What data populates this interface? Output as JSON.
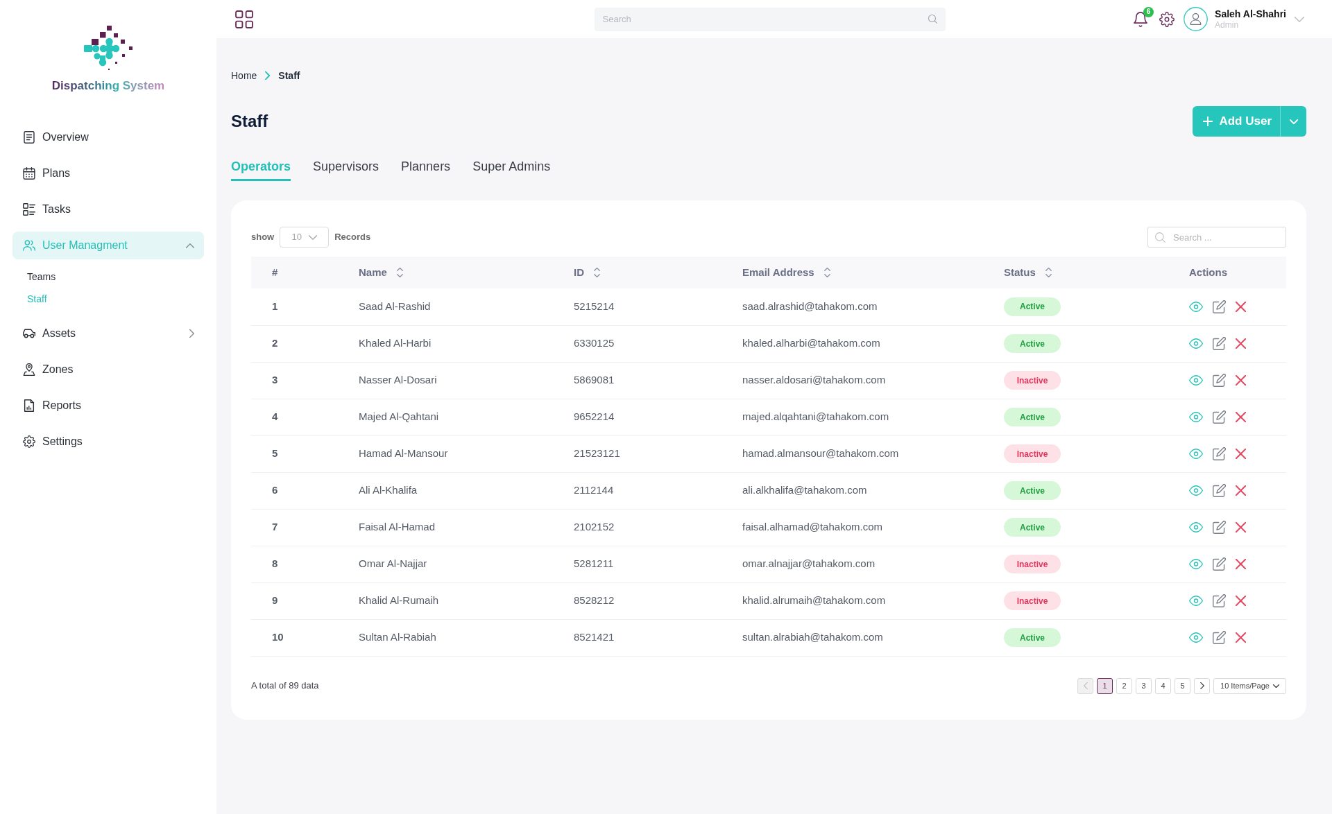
{
  "sidebar": {
    "logo_text": "Dispatching System",
    "items": [
      {
        "label": "Overview",
        "kind": "link",
        "selected": false
      },
      {
        "label": "Plans",
        "kind": "link",
        "selected": false
      },
      {
        "label": "Tasks",
        "kind": "link",
        "selected": false
      },
      {
        "label": "User Managment",
        "kind": "group",
        "selected": true,
        "expanded": true,
        "children": [
          {
            "label": "Teams",
            "selected": false
          },
          {
            "label": "Staff",
            "selected": true
          }
        ]
      },
      {
        "label": "Assets",
        "kind": "group",
        "selected": false,
        "expanded": false
      },
      {
        "label": "Zones",
        "kind": "link",
        "selected": false
      },
      {
        "label": "Reports",
        "kind": "link",
        "selected": false
      },
      {
        "label": "Settings",
        "kind": "link",
        "selected": false
      }
    ]
  },
  "top_bar": {
    "search": {
      "placeholder": "Search"
    },
    "notification_count": "6",
    "user": {
      "name": "Saleh Al-Shahri",
      "role": "Admin"
    }
  },
  "breadcrumb": [
    "Home",
    "Staff"
  ],
  "page_title": "Staff",
  "primary_action": {
    "label": "Add User"
  },
  "tabs": [
    {
      "label": "Operators",
      "selected": true
    },
    {
      "label": "Supervisors",
      "selected": false
    },
    {
      "label": "Planners",
      "selected": false
    },
    {
      "label": "Super Admins",
      "selected": false
    }
  ],
  "table": {
    "page_size": {
      "prefix": "show",
      "value": "10",
      "suffix": "Records"
    },
    "search": {
      "placeholder": "Search ..."
    },
    "columns": [
      {
        "label": "#",
        "sortable": false
      },
      {
        "label": "Name",
        "sortable": true
      },
      {
        "label": "ID",
        "sortable": true
      },
      {
        "label": "Email Address",
        "sortable": true
      },
      {
        "label": "Status",
        "sortable": true
      },
      {
        "label": "Actions",
        "sortable": false
      }
    ],
    "rows": [
      {
        "number": "1",
        "name": "Saad Al-Rashid",
        "id": "5215214",
        "email": "saad.alrashid@tahakom.com",
        "status": "Active",
        "active": true
      },
      {
        "number": "2",
        "name": "Khaled Al-Harbi",
        "id": "6330125",
        "email": "khaled.alharbi@tahakom.com",
        "status": "Active",
        "active": true
      },
      {
        "number": "3",
        "name": "Nasser Al-Dosari",
        "id": "5869081",
        "email": "nasser.aldosari@tahakom.com",
        "status": "Inactive",
        "active": false
      },
      {
        "number": "4",
        "name": "Majed Al-Qahtani",
        "id": "9652214",
        "email": "majed.alqahtani@tahakom.com",
        "status": "Active",
        "active": true
      },
      {
        "number": "5",
        "name": "Hamad Al-Mansour",
        "id": "21523121",
        "email": "hamad.almansour@tahakom.com",
        "status": "Inactive",
        "active": false
      },
      {
        "number": "6",
        "name": "Ali Al-Khalifa",
        "id": "2112144",
        "email": "ali.alkhalifa@tahakom.com",
        "status": "Active",
        "active": true
      },
      {
        "number": "7",
        "name": "Faisal Al-Hamad",
        "id": "2102152",
        "email": "faisal.alhamad@tahakom.com",
        "status": "Active",
        "active": true
      },
      {
        "number": "8",
        "name": "Omar Al-Najjar",
        "id": "5281211",
        "email": "omar.alnajjar@tahakom.com",
        "status": "Inactive",
        "active": false
      },
      {
        "number": "9",
        "name": "Khalid Al-Rumaih",
        "id": "8528212",
        "email": "khalid.alrumaih@tahakom.com",
        "status": "Inactive",
        "active": false
      },
      {
        "number": "10",
        "name": "Sultan Al-Rabiah",
        "id": "8521421",
        "email": "sultan.alrabiah@tahakom.com",
        "status": "Active",
        "active": true
      }
    ],
    "total": "A total of 89 data",
    "pagination": {
      "previous": {
        "disabled": true
      },
      "pages": [
        {
          "label": "1",
          "selected": true
        },
        {
          "label": "2",
          "selected": false
        },
        {
          "label": "3",
          "selected": false
        },
        {
          "label": "4",
          "selected": false
        },
        {
          "label": "5",
          "selected": false
        }
      ],
      "next": {
        "disabled": false
      },
      "page_size": "10 Items/Page"
    }
  }
}
